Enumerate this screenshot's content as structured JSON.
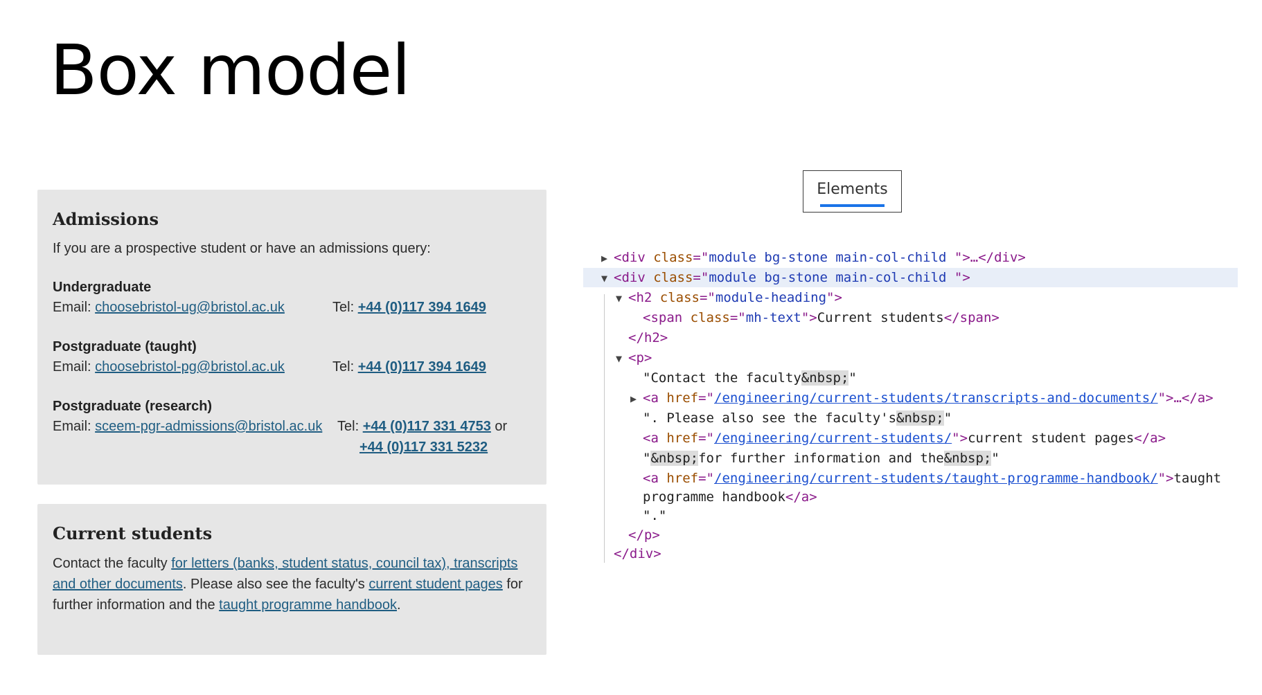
{
  "slide": {
    "title": "Box model"
  },
  "admissions": {
    "heading": "Admissions",
    "intro": "If you are a prospective student or have an admissions query:",
    "undergraduate": {
      "title": "Undergraduate",
      "email_label": "Email:",
      "email": "choosebristol-ug@bristol.ac.uk",
      "tel_label": "Tel:",
      "tel": "+44 (0)117 394 1649"
    },
    "pg_taught": {
      "title": "Postgraduate (taught)",
      "email_label": "Email:",
      "email": "choosebristol-pg@bristol.ac.uk",
      "tel_label": "Tel:",
      "tel": "+44 (0)117 394 1649"
    },
    "pg_research": {
      "title": "Postgraduate (research)",
      "email_label": "Email:",
      "email": "sceem-pgr-admissions@bristol.ac.uk",
      "tel_label": "Tel:",
      "tel": "+44 (0)117 331 4753",
      "or": "or",
      "tel2": "+44 (0)117 331 5232"
    }
  },
  "current": {
    "heading": "Current students",
    "text1": "Contact the faculty ",
    "link1": "for letters (banks, student status, council tax), transcripts and other documents",
    "text2": ". Please also see the faculty's ",
    "link2": "current student pages",
    "text3": " for further information and the ",
    "link3": "taught programme handbook",
    "text4": "."
  },
  "devtools": {
    "tab": "Elements",
    "dom": {
      "l1_open": "<div",
      "attr_class": "class",
      "eq_q": "=\"",
      "l1_val": "module bg-stone main-col-child ",
      "l1_tail": "\">…</div>",
      "l2_tail": "\">",
      "l3_open": "<h2",
      "l3_val": "module-heading",
      "l4_open": "<span",
      "l4_val": "mh-text",
      "l4_text": "Current students",
      "l4_close": "</span>",
      "l5": "</h2>",
      "l6": "<p>",
      "l7_a": "\"Contact the faculty",
      "nbsp": "&nbsp;",
      "quote": "\"",
      "a_open": "<a",
      "attr_href": "href",
      "url1": "/engineering/current-students/transcripts-and-documents/",
      "l8_tail": "\">…</a>",
      "l9_a": "\". Please also see the faculty's",
      "url2": "/engineering/current-students/",
      "l10_text": "current student pages",
      "a_close": "</a>",
      "l11_b": "for further information and the",
      "url3": "/engineering/current-students/taught-programme-handbook/",
      "l12_text": "taught",
      "l13_text": "programme handbook",
      "l14": "\".\"",
      "l15": "</p>",
      "l16": "</div>"
    }
  }
}
